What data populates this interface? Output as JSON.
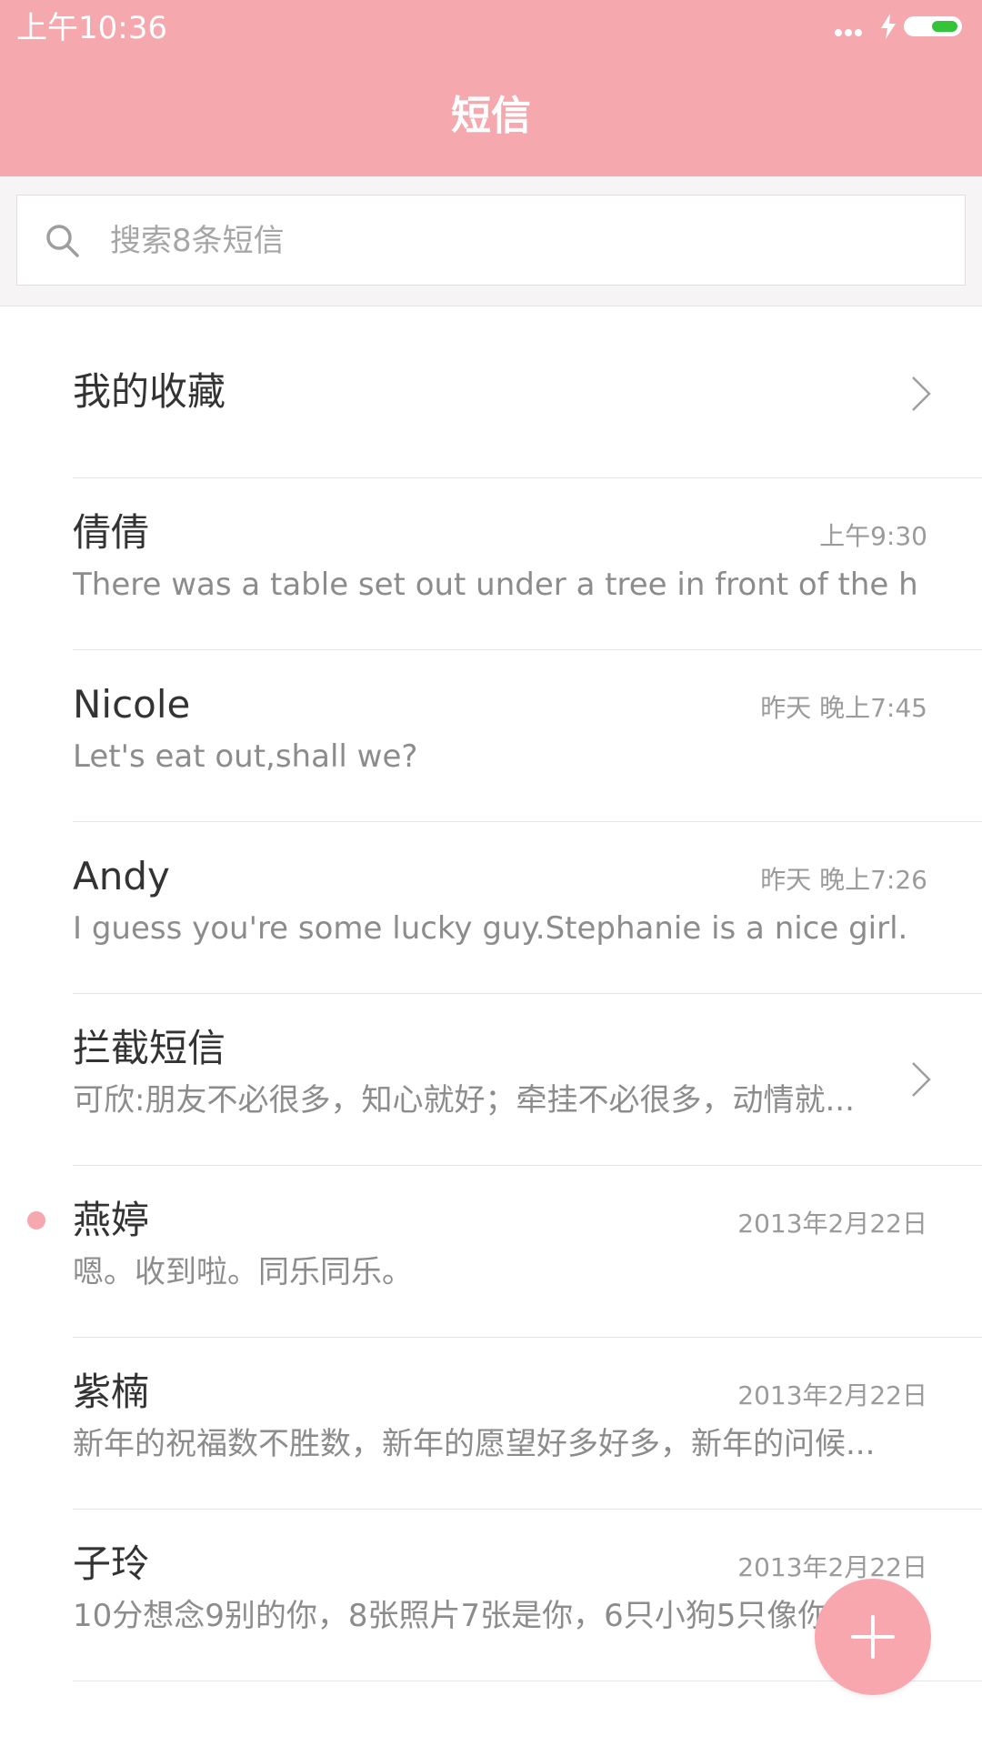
{
  "status_bar": {
    "time": "上午10:36"
  },
  "header": {
    "title": "短信"
  },
  "search": {
    "placeholder": "搜索8条短信"
  },
  "list": [
    {
      "name": "我的收藏",
      "time": "",
      "preview": "",
      "chevron": true,
      "unread": false
    },
    {
      "name": "倩倩",
      "time": "上午9:30",
      "preview": "There was a table set out under a tree in front of the ho...",
      "chevron": false,
      "unread": false
    },
    {
      "name": "Nicole",
      "time": "昨天 晚上7:45",
      "preview": "Let's eat out,shall we?",
      "chevron": false,
      "unread": false
    },
    {
      "name": "Andy",
      "time": "昨天 晚上7:26",
      "preview": "I guess you're some lucky guy.Stephanie is a nice girl.",
      "chevron": false,
      "unread": false
    },
    {
      "name": "拦截短信",
      "time": "",
      "preview": "可欣:朋友不必很多，知心就好；牵挂不必很多，动情就...",
      "chevron": true,
      "unread": false
    },
    {
      "name": "燕婷",
      "time": "2013年2月22日",
      "preview": "嗯。收到啦。同乐同乐。",
      "chevron": false,
      "unread": true
    },
    {
      "name": "紫楠",
      "time": "2013年2月22日",
      "preview": "新年的祝福数不胜数，新年的愿望好多好多，新年的问候...",
      "chevron": false,
      "unread": false
    },
    {
      "name": "子玲",
      "time": "2013年2月22日",
      "preview": "10分想念9别的你，8张照片7张是你，6只小狗5只像你",
      "chevron": false,
      "unread": false
    }
  ],
  "icons": {
    "search": "search-icon",
    "chevron": "chevron-right-icon",
    "compose": "plus-icon"
  },
  "colors": {
    "accent": "#f5a8ae",
    "unread": "#f5a8ae",
    "battery": "#34c43a"
  }
}
